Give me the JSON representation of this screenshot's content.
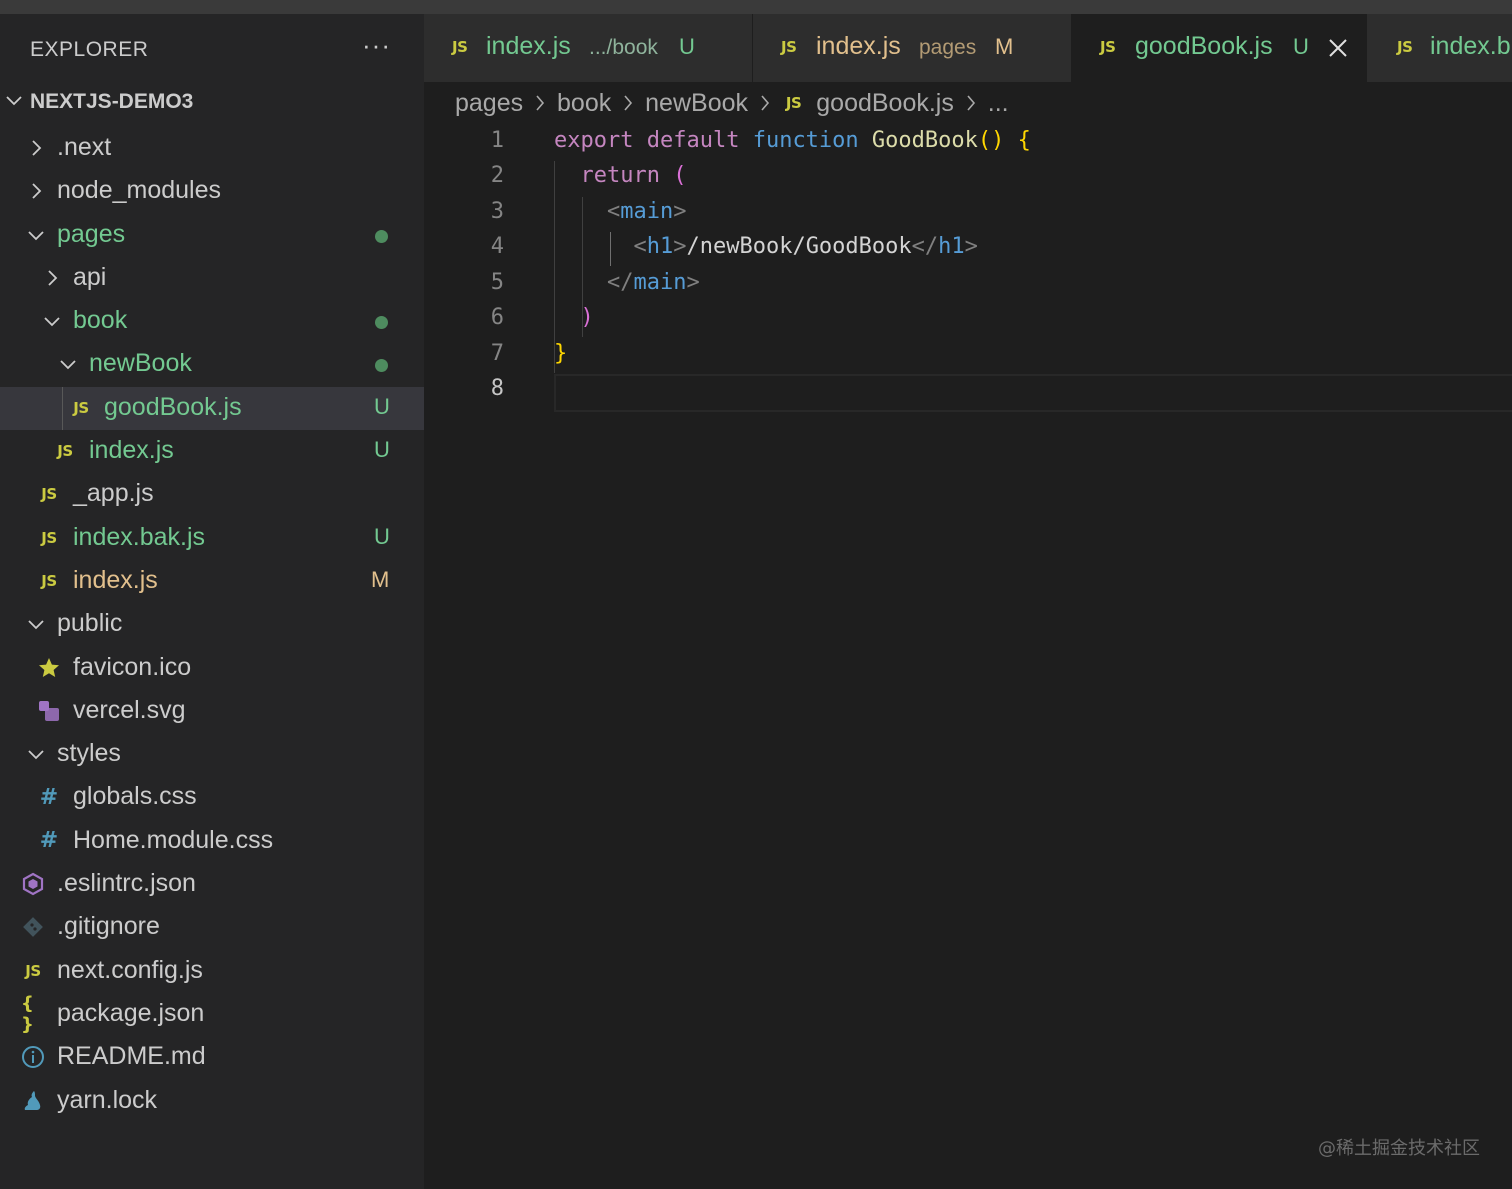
{
  "explorer": {
    "title": "EXPLORER",
    "more_label": "···",
    "project": "NEXTJS-DEMO3",
    "items": [
      {
        "label": ".next",
        "icon": "chevron-right-icon",
        "status": ""
      },
      {
        "label": "node_modules",
        "icon": "chevron-right-icon",
        "status": ""
      },
      {
        "label": "pages",
        "icon": "chevron-down-icon",
        "status": ""
      },
      {
        "label": "api",
        "icon": "chevron-right-icon",
        "status": ""
      },
      {
        "label": "book",
        "icon": "chevron-down-icon",
        "status": ""
      },
      {
        "label": "newBook",
        "icon": "chevron-down-icon",
        "status": ""
      },
      {
        "label": "goodBook.js",
        "icon": "js-file-icon",
        "icon_text": "JS",
        "status": "U"
      },
      {
        "label": "index.js",
        "icon": "js-file-icon",
        "icon_text": "JS",
        "status": "U"
      },
      {
        "label": "_app.js",
        "icon": "js-file-icon",
        "icon_text": "JS",
        "status": ""
      },
      {
        "label": "index.bak.js",
        "icon": "js-file-icon",
        "icon_text": "JS",
        "status": "U"
      },
      {
        "label": "index.js",
        "icon": "js-file-icon",
        "icon_text": "JS",
        "status": "M"
      },
      {
        "label": "public",
        "icon": "chevron-down-icon",
        "status": ""
      },
      {
        "label": "favicon.ico",
        "icon": "star-icon",
        "status": ""
      },
      {
        "label": "vercel.svg",
        "icon": "image-file-icon",
        "status": ""
      },
      {
        "label": "styles",
        "icon": "chevron-down-icon",
        "status": ""
      },
      {
        "label": "globals.css",
        "icon": "css-file-icon",
        "icon_text": "#",
        "status": ""
      },
      {
        "label": "Home.module.css",
        "icon": "css-file-icon",
        "icon_text": "#",
        "status": ""
      },
      {
        "label": ".eslintrc.json",
        "icon": "eslint-icon",
        "status": ""
      },
      {
        "label": ".gitignore",
        "icon": "git-icon",
        "status": ""
      },
      {
        "label": "next.config.js",
        "icon": "js-file-icon",
        "icon_text": "JS",
        "status": ""
      },
      {
        "label": "package.json",
        "icon": "json-file-icon",
        "icon_text": "{ }",
        "status": ""
      },
      {
        "label": "README.md",
        "icon": "info-icon",
        "status": ""
      },
      {
        "label": "yarn.lock",
        "icon": "yarn-icon",
        "status": ""
      }
    ]
  },
  "tabs": [
    {
      "icon_text": "JS",
      "name": "index.js",
      "description": ".../book",
      "status": "U"
    },
    {
      "icon_text": "JS",
      "name": "index.js",
      "description": "pages",
      "status": "M"
    },
    {
      "icon_text": "JS",
      "name": "goodBook.js",
      "description": "",
      "status": "U",
      "active": true
    },
    {
      "icon_text": "JS",
      "name": "index.b",
      "description": "",
      "status": ""
    }
  ],
  "breadcrumb": {
    "items": [
      "pages",
      "book",
      "newBook",
      "goodBook.js",
      "..."
    ],
    "file_icon_text": "JS"
  },
  "editor": {
    "line_numbers": [
      "1",
      "2",
      "3",
      "4",
      "5",
      "6",
      "7",
      "8"
    ],
    "current_line": "8",
    "code": {
      "l1": {
        "kw1": "export",
        "kw2": "default",
        "kw3": "function",
        "fn": "GoodBook",
        "parens": "()",
        "brace": "{"
      },
      "l2": {
        "kw": "return",
        "paren": "("
      },
      "l3": {
        "lt": "<",
        "tag": "main",
        "gt": ">"
      },
      "l4": {
        "lt": "<",
        "tag": "h1",
        "gt": ">",
        "text": "/newBook/GoodBook",
        "close_lt": "</",
        "close_tag": "h1",
        "close_gt": ">"
      },
      "l5": {
        "lt": "</",
        "tag": "main",
        "gt": ">"
      },
      "l6": {
        "paren": ")"
      },
      "l7": {
        "brace": "}"
      }
    }
  },
  "watermark": "@稀土掘金技术社区",
  "colors": {
    "keyword": "#c586c0",
    "function_kw": "#569cd6",
    "function_name": "#dcdcaa",
    "bracket_gold": "#ffd700",
    "bracket_pink": "#da70d6",
    "tag": "#569cd6",
    "punct": "#808080",
    "untracked": "#73c991",
    "modified": "#e2c08d"
  }
}
